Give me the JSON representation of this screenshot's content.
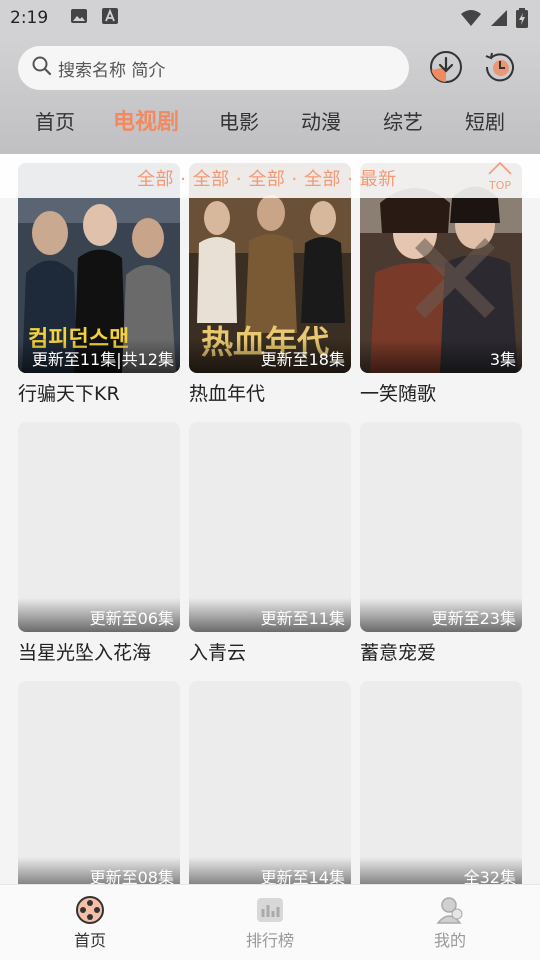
{
  "status": {
    "time": "2:19"
  },
  "search": {
    "placeholder": "搜索名称 简介"
  },
  "tabs": [
    {
      "label": "首页"
    },
    {
      "label": "电视剧"
    },
    {
      "label": "电影"
    },
    {
      "label": "动漫"
    },
    {
      "label": "综艺"
    },
    {
      "label": "短剧"
    }
  ],
  "filter": {
    "text": "全部 · 全部 · 全部 · 全部 · 最新",
    "top_label": "TOP"
  },
  "shows": [
    {
      "title": "行骗天下KR",
      "badge": "更新至11集|共12集"
    },
    {
      "title": "热血年代",
      "badge": "更新至18集"
    },
    {
      "title": "一笑随歌",
      "badge": "3集"
    },
    {
      "title": "当星光坠入花海",
      "badge": "更新至06集"
    },
    {
      "title": "入青云",
      "badge": "更新至11集"
    },
    {
      "title": "蓄意宠爱",
      "badge": "更新至23集"
    },
    {
      "title": "",
      "badge": "更新至08集"
    },
    {
      "title": "",
      "badge": "更新至14集"
    },
    {
      "title": "",
      "badge": "全32集"
    }
  ],
  "poster_texts": {
    "p0": "컴피던스맨",
    "p1": "热血年代"
  },
  "bottom_nav": [
    {
      "label": "首页"
    },
    {
      "label": "排行榜"
    },
    {
      "label": "我的"
    }
  ],
  "colors": {
    "accent": "#f08a60",
    "header_bg": "#c8c8ca"
  }
}
